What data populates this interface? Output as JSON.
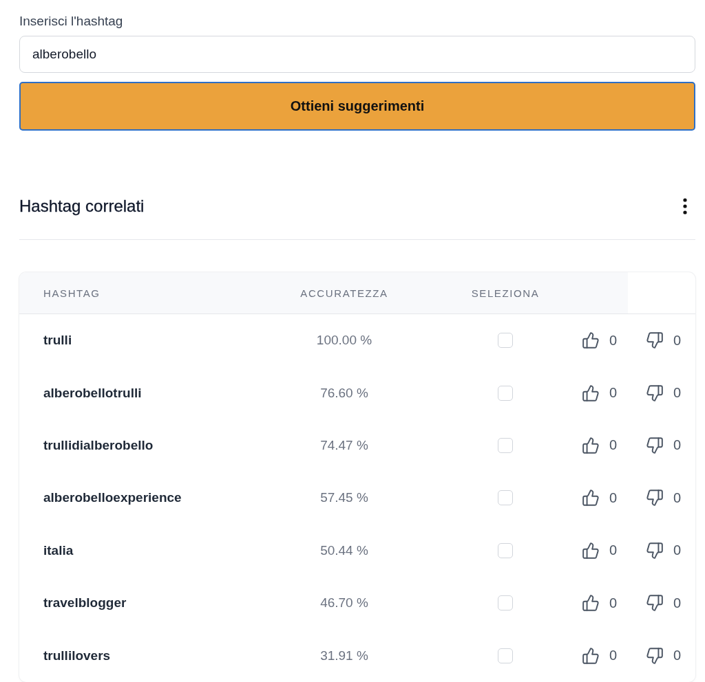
{
  "form": {
    "label": "Inserisci l'hashtag",
    "input": {
      "value": "alberobello"
    },
    "submit_button": {
      "label": "Ottieni suggerimenti",
      "focused": true
    }
  },
  "section": {
    "title": "Hashtag correlati"
  },
  "table": {
    "columns": [
      "HASHTAG",
      "ACCURATEZZA",
      "SELEZIONA"
    ],
    "rows": [
      {
        "hashtag": "trulli",
        "accuracy": "100.00 %",
        "checked": false,
        "likes": "0",
        "dislikes": "0"
      },
      {
        "hashtag": "alberobellotrulli",
        "accuracy": "76.60 %",
        "checked": false,
        "likes": "0",
        "dislikes": "0"
      },
      {
        "hashtag": "trullidialberobello",
        "accuracy": "74.47 %",
        "checked": false,
        "likes": "0",
        "dislikes": "0"
      },
      {
        "hashtag": "alberobelloexperience",
        "accuracy": "57.45 %",
        "checked": false,
        "likes": "0",
        "dislikes": "0"
      },
      {
        "hashtag": "italia",
        "accuracy": "50.44 %",
        "checked": false,
        "likes": "0",
        "dislikes": "0"
      },
      {
        "hashtag": "travelblogger",
        "accuracy": "46.70 %",
        "checked": false,
        "likes": "0",
        "dislikes": "0"
      },
      {
        "hashtag": "trullilovers",
        "accuracy": "31.91 %",
        "checked": false,
        "likes": "0",
        "dislikes": "0"
      }
    ]
  }
}
